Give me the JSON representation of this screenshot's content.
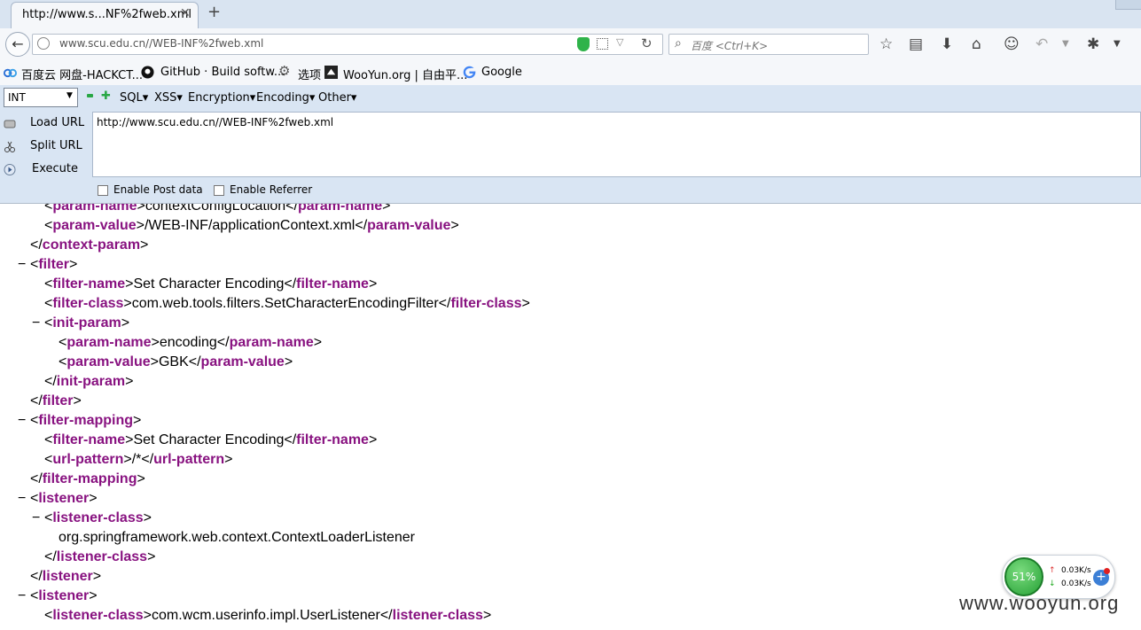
{
  "tab": {
    "title": "http://www.s...NF%2fweb.xml",
    "close": "✕",
    "new": "+"
  },
  "nav": {
    "url": "www.scu.edu.cn//WEB-INF%2fweb.xml",
    "search_placeholder": "百度 <Ctrl+K>"
  },
  "bookmarks": [
    {
      "label": "百度云 网盘-HACKCT..."
    },
    {
      "label": "GitHub · Build softw..."
    },
    {
      "label": "选项"
    },
    {
      "label": "WooYun.org | 自由平..."
    },
    {
      "label": "Google"
    }
  ],
  "hackbar": {
    "select_value": "INT",
    "menus": [
      "SQL▾",
      "XSS▾",
      "Encryption▾",
      "Encoding▾",
      "Other▾"
    ],
    "load_url": "Load URL",
    "split_url": "Split URL",
    "execute": "Execute",
    "url_value": "http://www.scu.edu.cn//WEB-INF%2fweb.xml",
    "enable_post": "Enable Post data",
    "enable_referrer": "Enable Referrer"
  },
  "xml_lines": [
    {
      "indent": 2,
      "toggle": false,
      "tag": "param-name",
      "text": "contextConfigLocation",
      "close": true
    },
    {
      "indent": 2,
      "toggle": false,
      "tag": "param-value",
      "text": "/WEB-INF/applicationContext.xml",
      "close": true
    },
    {
      "indent": 1,
      "toggle": false,
      "end": "context-param"
    },
    {
      "indent": 1,
      "toggle": true,
      "open": "filter"
    },
    {
      "indent": 2,
      "toggle": false,
      "tag": "filter-name",
      "text": "Set Character Encoding",
      "close": true
    },
    {
      "indent": 2,
      "toggle": false,
      "tag": "filter-class",
      "text": "com.web.tools.filters.SetCharacterEncodingFilter",
      "close": true
    },
    {
      "indent": 2,
      "toggle": true,
      "open": "init-param"
    },
    {
      "indent": 3,
      "toggle": false,
      "tag": "param-name",
      "text": "encoding",
      "close": true
    },
    {
      "indent": 3,
      "toggle": false,
      "tag": "param-value",
      "text": "GBK",
      "close": true
    },
    {
      "indent": 2,
      "toggle": false,
      "end": "init-param"
    },
    {
      "indent": 1,
      "toggle": false,
      "end": "filter"
    },
    {
      "indent": 1,
      "toggle": true,
      "open": "filter-mapping"
    },
    {
      "indent": 2,
      "toggle": false,
      "tag": "filter-name",
      "text": "Set Character Encoding",
      "close": true
    },
    {
      "indent": 2,
      "toggle": false,
      "tag": "url-pattern",
      "text": "/*",
      "close": true
    },
    {
      "indent": 1,
      "toggle": false,
      "end": "filter-mapping"
    },
    {
      "indent": 1,
      "toggle": true,
      "open": "listener"
    },
    {
      "indent": 2,
      "toggle": true,
      "open": "listener-class"
    },
    {
      "indent": 3,
      "toggle": false,
      "plain": "org.springframework.web.context.ContextLoaderListener"
    },
    {
      "indent": 2,
      "toggle": false,
      "end": "listener-class"
    },
    {
      "indent": 1,
      "toggle": false,
      "end": "listener"
    },
    {
      "indent": 1,
      "toggle": true,
      "open": "listener"
    },
    {
      "indent": 2,
      "toggle": false,
      "tag": "listener-class",
      "text": "com.wcm.userinfo.impl.UserListener",
      "close": true
    }
  ],
  "speed": {
    "percent": "51%",
    "up": "0.03K/s",
    "down": "0.03K/s",
    "up_arrow": "↑",
    "down_arrow": "↓"
  },
  "watermark": "www.wooyun.org",
  "icons": [
    "back-arrow-icon",
    "globe-icon",
    "shield-icon",
    "qr-icon",
    "reload-icon",
    "search-icon",
    "star-icon",
    "library-icon",
    "download-icon",
    "home-icon",
    "chat-icon",
    "undo-icon",
    "bug-icon"
  ]
}
